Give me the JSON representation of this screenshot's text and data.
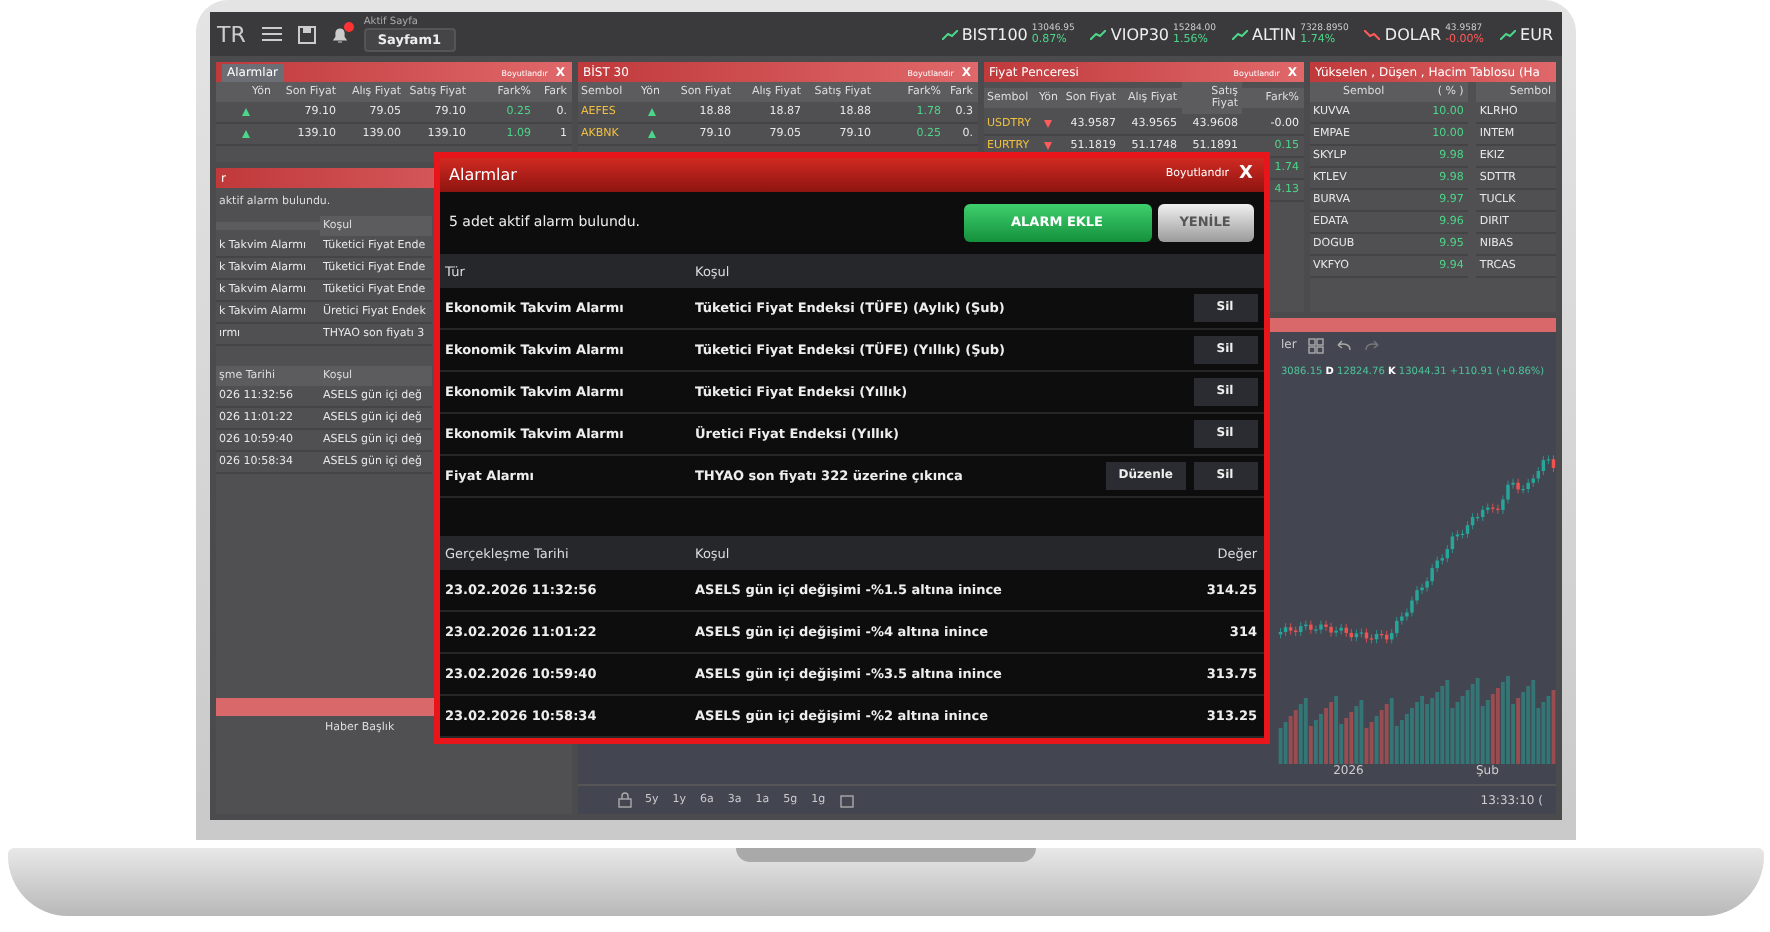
{
  "topbar": {
    "brand": "TR",
    "page_label": "Aktif Sayfa",
    "page_name": "Sayfam1",
    "notification": true
  },
  "tickers": [
    {
      "name": "BIST100",
      "value": "13046.95",
      "change": "0.87%",
      "rising": true
    },
    {
      "name": "VIOP30",
      "value": "15284.00",
      "change": "1.56%",
      "rising": true
    },
    {
      "name": "ALTIN",
      "value": "7328.8950",
      "change": "1.74%",
      "rising": true
    },
    {
      "name": "DOLAR",
      "value": "43.9587",
      "change": "-0.00%",
      "rising": false
    },
    {
      "name": "EUR",
      "rising": true
    }
  ],
  "watchlist": {
    "title": "Alarmlar",
    "resize": "Boyutlandır",
    "close": "X",
    "direction_column": "Yön",
    "columns": [
      "Son Fiyat",
      "Alış Fiyat",
      "Satış Fiyat",
      "Fark%",
      "Fark"
    ],
    "rows": [
      {
        "rising": true,
        "cells": [
          "79.10",
          "79.05",
          "79.10",
          "0.25",
          "0."
        ]
      },
      {
        "rising": true,
        "cells": [
          "139.10",
          "139.00",
          "139.10",
          "1.09",
          "1"
        ]
      }
    ]
  },
  "bist30": {
    "title": "BİST 30",
    "resize": "Boyutlandır",
    "close": "X",
    "symbol_column": "Sembol",
    "direction_column": "Yön",
    "columns": [
      "Son Fiyat",
      "Alış Fiyat",
      "Satış Fiyat",
      "Fark%",
      "Fark"
    ],
    "rows": [
      {
        "symbol": "AEFES",
        "rising": true,
        "cells": [
          "18.88",
          "18.87",
          "18.88",
          "1.78",
          "0.3"
        ]
      },
      {
        "symbol": "AKBNK",
        "rising": true,
        "cells": [
          "79.10",
          "79.05",
          "79.10",
          "0.25",
          "0."
        ]
      }
    ]
  },
  "price_window": {
    "title": "Fiyat Penceresi",
    "resize": "Boyutlandır",
    "close": "X",
    "symbol_column": "Sembol",
    "direction_column": "Yön",
    "columns": [
      "Son Fiyat",
      "Alış Fiyat",
      "Satış Fiyat"
    ],
    "change_column": "Fark%",
    "rows": [
      {
        "symbol": "USDTRY",
        "rising": false,
        "cells": [
          "43.9587",
          "43.9565",
          "43.9608"
        ],
        "change": "-0.00"
      },
      {
        "symbol": "EURTRY",
        "rising": false,
        "cells": [
          "51.1819",
          "51.1748",
          "51.1891"
        ],
        "change": "0.15"
      },
      {
        "change": "1.74"
      },
      {
        "change": "4.13"
      }
    ]
  },
  "movers": {
    "title": "Yükselen , Düşen , Hacim Tablosu (Ha",
    "columns": [
      "Sembol",
      "( % )",
      "Sembol"
    ],
    "rows": [
      {
        "symbol": "KUVVA",
        "change": "10.00",
        "symbol_2": "KLRHO"
      },
      {
        "symbol": "EMPAE",
        "change": "10.00",
        "symbol_2": "INTEM"
      },
      {
        "symbol": "SKYLP",
        "change": "9.98",
        "symbol_2": "EKIZ"
      },
      {
        "symbol": "KTLEV",
        "change": "9.98",
        "symbol_2": "SDTTR"
      },
      {
        "symbol": "BURVA",
        "change": "9.97",
        "symbol_2": "TUCLK"
      },
      {
        "symbol": "EDATA",
        "change": "9.96",
        "symbol_2": "DIRIT"
      },
      {
        "symbol": "DOGUB",
        "change": "9.95",
        "symbol_2": "NIBAS"
      },
      {
        "symbol": "VKFYO",
        "change": "9.94",
        "symbol_2": "TRCAS"
      }
    ]
  },
  "alarm_panel": {
    "title": "r",
    "message": "aktif alarm bulundu.",
    "column": "Koşul",
    "rows": [
      {
        "type": "k Takvim Alarmı",
        "condition": "Tüketici Fiyat Ende"
      },
      {
        "type": "k Takvim Alarmı",
        "condition": "Tüketici Fiyat Ende"
      },
      {
        "type": "k Takvim Alarmı",
        "condition": "Tüketici Fiyat Ende"
      },
      {
        "type": "k Takvim Alarmı",
        "condition": "Üretici Fiyat Endek"
      },
      {
        "type": "ırmı",
        "condition": "THYAO son fiyatı 3"
      }
    ],
    "history_columns": [
      "şme Tarihi",
      "Koşul"
    ],
    "history": [
      {
        "date": "026 11:32:56",
        "condition": "ASELS gün içi değ"
      },
      {
        "date": "026 11:01:22",
        "condition": "ASELS gün içi değ"
      },
      {
        "date": "026 10:59:40",
        "condition": "ASELS gün içi değ"
      },
      {
        "date": "026 10:58:34",
        "condition": "ASELS gün içi değ"
      }
    ],
    "news_column": "Haber Başlık"
  },
  "chart": {
    "toolbar_label": "ler",
    "ohlc": "3086.15 **D** 12824.76 **K** 13044.31 +110.91 (+0.86%)",
    "axis_labels": [
      "2026",
      "Şub"
    ],
    "timeframes": [
      "5y",
      "1y",
      "6a",
      "3a",
      "1a",
      "5g",
      "1g"
    ],
    "time": "13:33:10 ("
  },
  "dialog": {
    "title": "Alarmlar",
    "resize": "Boyutlandır",
    "close": "X",
    "message": "5 adet aktif alarm bulundu.",
    "add_button": "ALARM EKLE",
    "refresh_button": "YENİLE",
    "active_columns": [
      "Tür",
      "Koşul"
    ],
    "active": [
      {
        "type": "Ekonomik Takvim Alarmı",
        "condition": "Tüketici Fiyat Endeksi (TÜFE) (Aylık) (Şub)",
        "actions": [
          "Sil"
        ]
      },
      {
        "type": "Ekonomik Takvim Alarmı",
        "condition": "Tüketici Fiyat Endeksi (TÜFE) (Yıllık) (Şub)",
        "actions": [
          "Sil"
        ]
      },
      {
        "type": "Ekonomik Takvim Alarmı",
        "condition": "Tüketici Fiyat Endeksi (Yıllık)",
        "actions": [
          "Sil"
        ]
      },
      {
        "type": "Ekonomik Takvim Alarmı",
        "condition": "Üretici Fiyat Endeksi (Yıllık)",
        "actions": [
          "Sil"
        ]
      },
      {
        "type": "Fiyat Alarmı",
        "condition": "THYAO son fiyatı 322 üzerine çıkınca",
        "actions": [
          "Düzenle",
          "Sil"
        ]
      }
    ],
    "history_columns": [
      "Gerçekleşme Tarihi",
      "Koşul",
      "Değer"
    ],
    "history": [
      {
        "date": "23.02.2026 11:32:56",
        "condition": "ASELS gün içi değişimi -%1.5 altına inince",
        "value": "314.25"
      },
      {
        "date": "23.02.2026 11:01:22",
        "condition": "ASELS gün içi değişimi -%4 altına inince",
        "value": "314"
      },
      {
        "date": "23.02.2026 10:59:40",
        "condition": "ASELS gün içi değişimi -%3.5 altına inince",
        "value": "313.75"
      },
      {
        "date": "23.02.2026 10:58:34",
        "condition": "ASELS gün içi değişimi -%2 altına inince",
        "value": "313.25"
      }
    ]
  }
}
